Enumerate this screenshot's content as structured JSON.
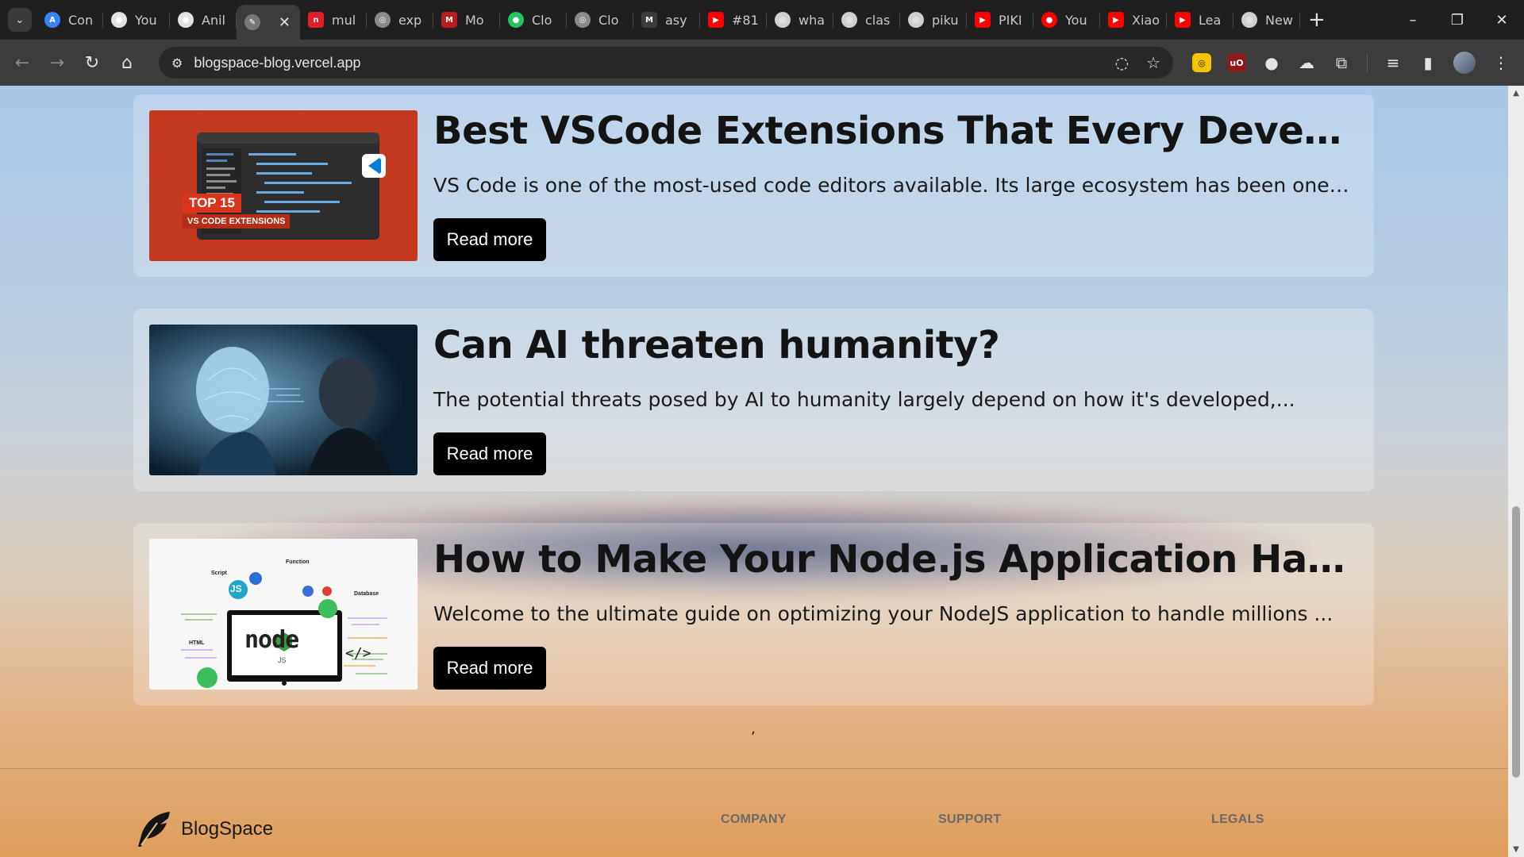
{
  "browser": {
    "tabs": [
      {
        "title": "Con",
        "color": "#3b82f6",
        "glyph": "A"
      },
      {
        "title": "You",
        "color": "#e3e3e3",
        "glyph": "●"
      },
      {
        "title": "Anil",
        "color": "#e3e3e3",
        "glyph": "●"
      },
      {
        "title": "",
        "color": "#777777",
        "glyph": "✎",
        "active": true
      },
      {
        "title": "mul",
        "color": "#e11d2a",
        "glyph": "n"
      },
      {
        "title": "exp",
        "color": "#8a8a8a",
        "glyph": "◎"
      },
      {
        "title": "Mo",
        "color": "#b91c1c",
        "glyph": "M"
      },
      {
        "title": "Clo",
        "color": "#22c55e",
        "glyph": "●"
      },
      {
        "title": "Clo",
        "color": "#8a8a8a",
        "glyph": "◎"
      },
      {
        "title": "asy",
        "color": "#3c3c3c",
        "glyph": "M"
      },
      {
        "title": "#81",
        "color": "#ff0000",
        "glyph": "▶"
      },
      {
        "title": "wha",
        "color": "#d0d0d0",
        "glyph": "◎"
      },
      {
        "title": "clas",
        "color": "#d0d0d0",
        "glyph": "◎"
      },
      {
        "title": "piku",
        "color": "#d0d0d0",
        "glyph": "◎"
      },
      {
        "title": "PIKI",
        "color": "#ff0000",
        "glyph": "▶"
      },
      {
        "title": "You",
        "color": "#ff0000",
        "glyph": "●"
      },
      {
        "title": "Xiao",
        "color": "#ff0000",
        "glyph": "▶"
      },
      {
        "title": "Lea",
        "color": "#ff0000",
        "glyph": "▶"
      },
      {
        "title": "New",
        "color": "#d0d0d0",
        "glyph": "◎"
      }
    ],
    "url": "blogspace-blog.vercel.app"
  },
  "posts": [
    {
      "title": "Best VSCode Extensions That Every Developer...",
      "excerpt": "VS Code is one of the most-used code editors available. Its large ecosystem has been one ...",
      "button": "Read more",
      "image": {
        "badge": "TOP 15",
        "badge_sub": "VS CODE EXTENSIONS"
      }
    },
    {
      "title": "Can AI threaten humanity?",
      "excerpt": "The potential threats posed by AI to humanity largely depend on how it's developed,...",
      "button": "Read more"
    },
    {
      "title": "How to Make Your Node.js Application Handle...",
      "excerpt": "Welcome to the ultimate guide on optimizing your NodeJS application to handle millions ...",
      "button": "Read more",
      "image": {
        "labels": [
          "Script",
          "Function",
          "Database",
          "HTML",
          "JS",
          "node",
          "JS",
          "</>"
        ]
      }
    }
  ],
  "stray_text": ",",
  "footer": {
    "brand": "BlogSpace",
    "columns": [
      "COMPANY",
      "SUPPORT",
      "LEGALS"
    ]
  }
}
